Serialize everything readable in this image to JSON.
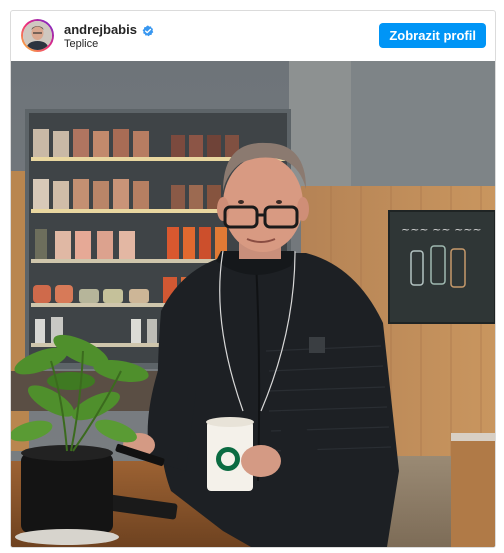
{
  "post": {
    "username": "andrejbabis",
    "location": "Teplice",
    "view_profile_label": "Zobrazit profil",
    "verified": true
  },
  "colors": {
    "accent": "#0095f6",
    "verified_badge": "#3897f0",
    "text": "#262626"
  },
  "icons": {
    "verified": "verified-badge-icon"
  }
}
